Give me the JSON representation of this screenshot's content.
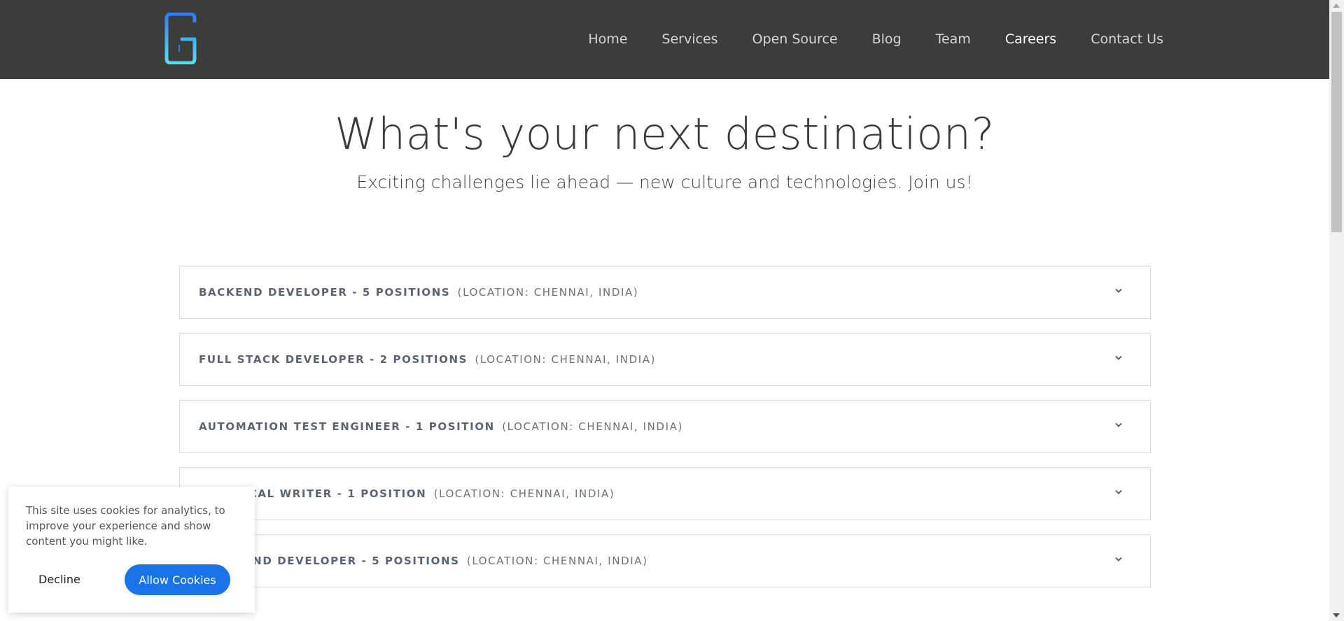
{
  "header": {
    "logo_icon": "g-logo-icon",
    "logo_color_top": "#2f7df6",
    "logo_color_bottom": "#4fe0f0",
    "background": "#3c3c3a",
    "nav": [
      {
        "label": "Home",
        "active": false
      },
      {
        "label": "Services",
        "active": false
      },
      {
        "label": "Open Source",
        "active": false
      },
      {
        "label": "Blog",
        "active": false
      },
      {
        "label": "Team",
        "active": false
      },
      {
        "label": "Careers",
        "active": true
      },
      {
        "label": "Contact Us",
        "active": false
      }
    ]
  },
  "hero": {
    "title": "What's your next destination?",
    "subtitle": "Exciting challenges lie ahead — new culture and technologies. Join us!"
  },
  "jobs": [
    {
      "role": "BACKEND DEVELOPER - 5 POSITIONS",
      "location": "(LOCATION: CHENNAI, INDIA)",
      "icon": "chevron-down-icon"
    },
    {
      "role": "FULL STACK DEVELOPER - 2 POSITIONS",
      "location": "(LOCATION: CHENNAI, INDIA)",
      "icon": "chevron-down-icon"
    },
    {
      "role": "AUTOMATION TEST ENGINEER - 1 POSITION",
      "location": "(LOCATION: CHENNAI, INDIA)",
      "icon": "chevron-down-icon"
    },
    {
      "role": "TECHNICAL WRITER - 1 POSITION",
      "location": "(LOCATION: CHENNAI, INDIA)",
      "icon": "chevron-down-icon"
    },
    {
      "role": "FRONTEND DEVELOPER - 5 POSITIONS",
      "location": "(LOCATION: CHENNAI, INDIA)",
      "icon": "chevron-down-icon"
    }
  ],
  "cookie_banner": {
    "text": "This site uses cookies for analytics, to improve your experience and show content you might like.",
    "decline_label": "Decline",
    "allow_label": "Allow Cookies",
    "allow_color": "#1a73e8"
  }
}
